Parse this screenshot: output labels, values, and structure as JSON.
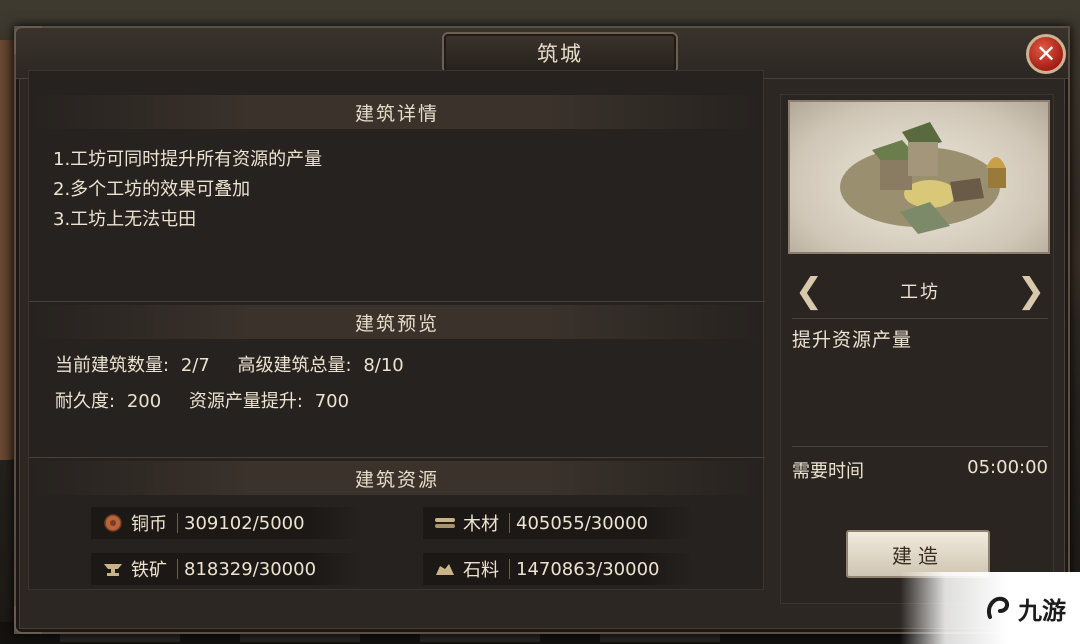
{
  "dialog": {
    "title": "筑城",
    "close_symbol": "✕"
  },
  "details": {
    "heading": "建筑详情",
    "lines": [
      "1.工坊可同时提升所有资源的产量",
      "2.多个工坊的效果可叠加",
      "3.工坊上无法屯田"
    ]
  },
  "preview": {
    "heading": "建筑预览",
    "current_count_label": "当前建筑数量:",
    "current_count_value": "2/7",
    "advanced_total_label": "高级建筑总量:",
    "advanced_total_value": "8/10",
    "durability_label": "耐久度:",
    "durability_value": "200",
    "boost_label": "资源产量提升:",
    "boost_value": "700"
  },
  "resources": {
    "heading": "建筑资源",
    "items": [
      {
        "name": "铜币",
        "value": "309102/5000",
        "icon": "copper-coin-icon",
        "color": "#b8643c"
      },
      {
        "name": "木材",
        "value": "405055/30000",
        "icon": "wood-icon",
        "color": "#c9b48a"
      },
      {
        "name": "铁矿",
        "value": "818329/30000",
        "icon": "iron-anvil-icon",
        "color": "#c9b48a"
      },
      {
        "name": "石料",
        "value": "1470863/30000",
        "icon": "stone-icon",
        "color": "#c9b48a"
      }
    ]
  },
  "building": {
    "name": "工坊",
    "effect": "提升资源产量",
    "time_label": "需要时间",
    "time_value": "05:00:00",
    "build_button": "建造",
    "prev_symbol": "❮",
    "next_symbol": "❯"
  },
  "watermark": {
    "text": "九游"
  },
  "colors": {
    "panel": "#2c2723",
    "border": "#5b4f44",
    "text": "#ece2d0",
    "close": "#c0392b",
    "button": "#e8e0cf"
  }
}
